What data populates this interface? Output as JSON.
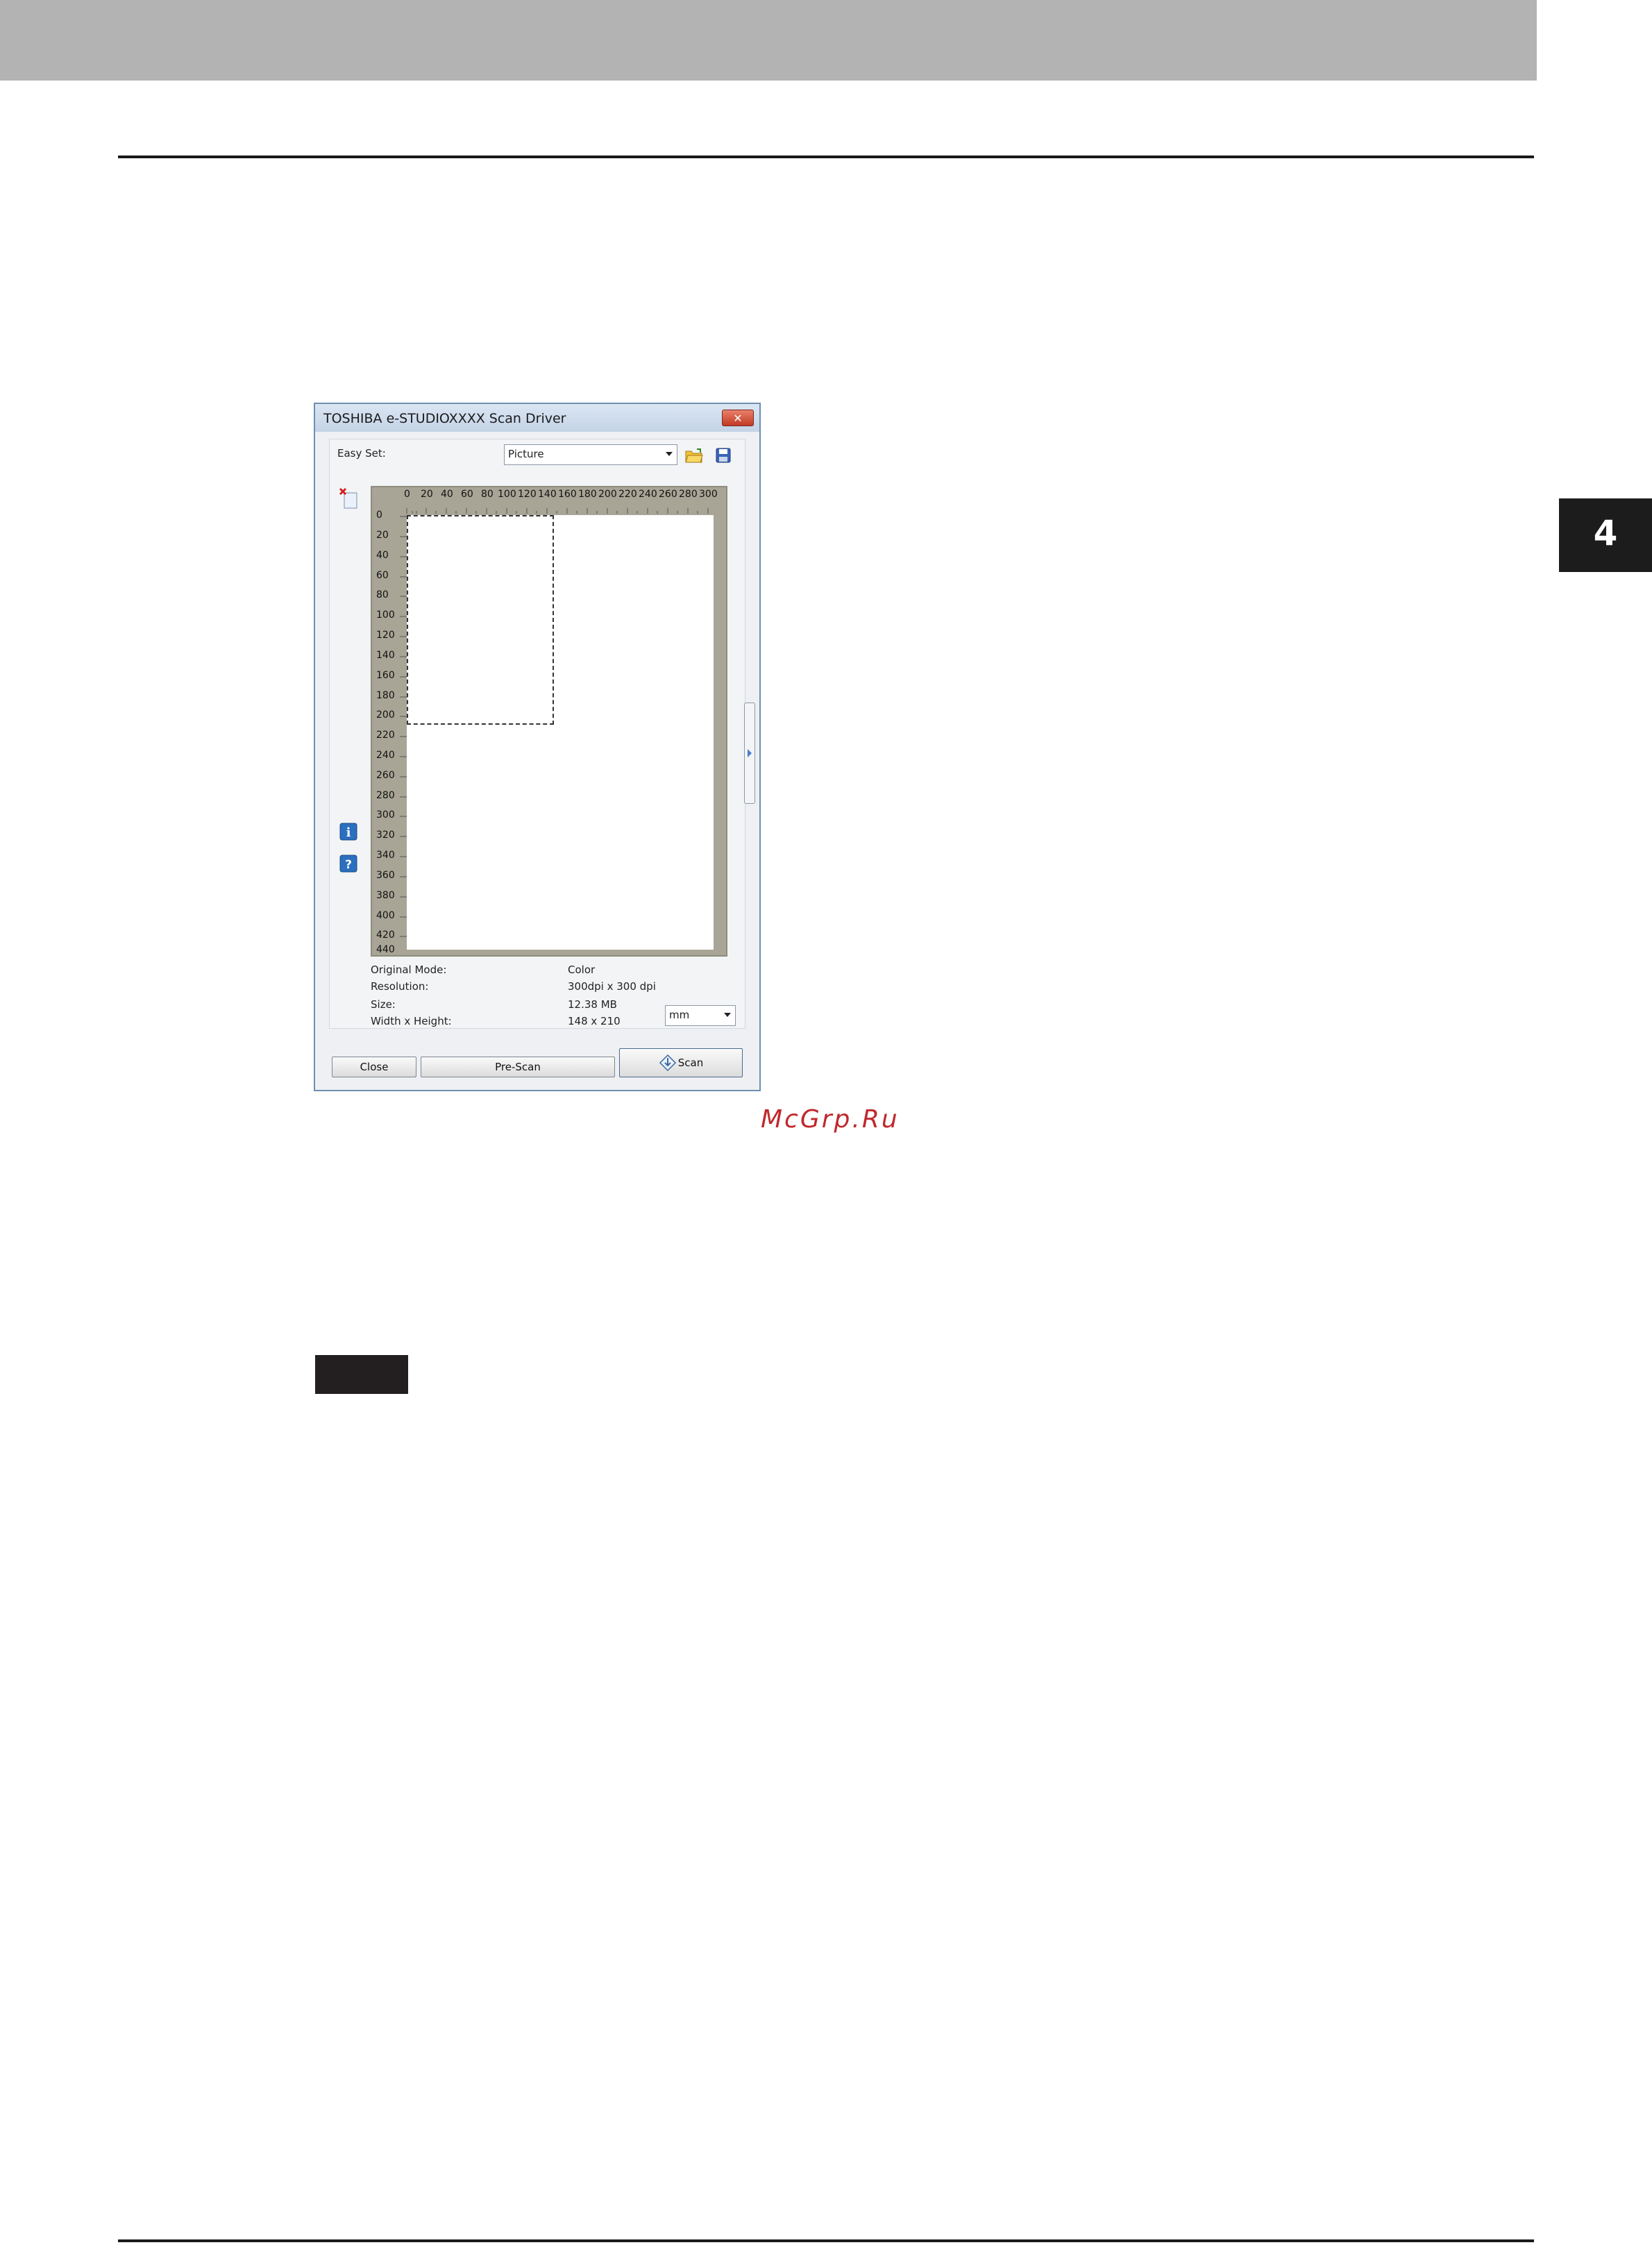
{
  "page": {
    "chapter_number": "4",
    "watermark": "McGrp.Ru"
  },
  "dialog": {
    "title": "TOSHIBA e-STUDIOXXXX Scan Driver",
    "close_glyph": "✕",
    "easy_set_label": "Easy Set:",
    "easy_set_value": "Picture",
    "icons": [
      "open-folder-icon",
      "save-disk-icon",
      "delete-page-icon",
      "info-icon",
      "help-icon"
    ],
    "ruler": {
      "top_ticks": [
        "0",
        "20",
        "40",
        "60",
        "80",
        "100",
        "120",
        "140",
        "160",
        "180",
        "200",
        "220",
        "240",
        "260",
        "280",
        "300"
      ],
      "left_ticks": [
        "0",
        "20",
        "40",
        "60",
        "80",
        "100",
        "120",
        "140",
        "160",
        "180",
        "200",
        "220",
        "240",
        "260",
        "280",
        "300",
        "320",
        "340",
        "360",
        "380",
        "400",
        "420",
        "440"
      ]
    },
    "info": {
      "original_mode_label": "Original Mode:",
      "original_mode_value": "Color",
      "resolution_label": "Resolution:",
      "resolution_value": "300dpi x 300 dpi",
      "size_label": "Size:",
      "size_value": "12.38 MB",
      "wh_label": "Width x Height:",
      "wh_value": "148 x 210",
      "unit_value": "mm"
    },
    "buttons": {
      "close": "Close",
      "prescan": "Pre-Scan",
      "scan": "Scan"
    }
  }
}
